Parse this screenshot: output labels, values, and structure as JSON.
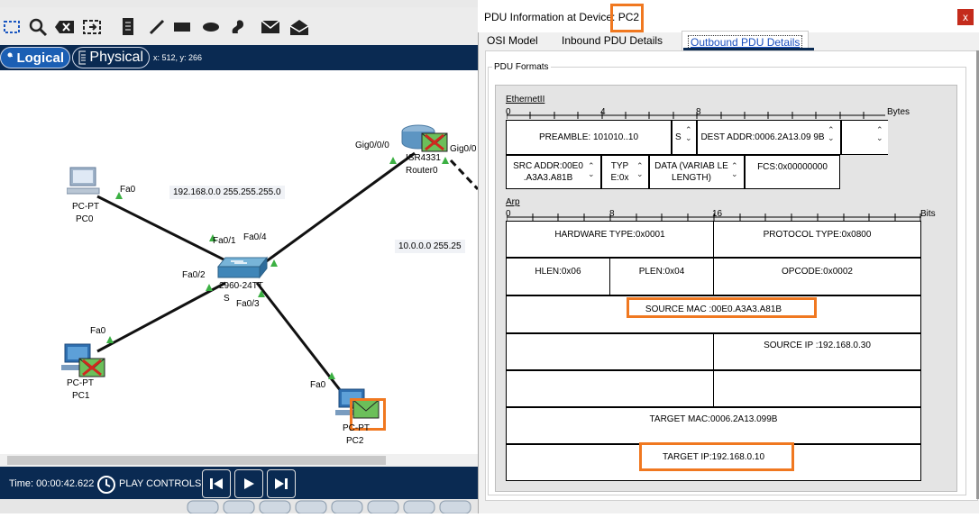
{
  "workspace": {
    "mode_logical": "Logical",
    "mode_physical": "Physical",
    "coords": "x: 512, y: 266",
    "devices": {
      "pc0": {
        "type": "PC-PT",
        "name": "PC0"
      },
      "pc1": {
        "type": "PC-PT",
        "name": "PC1"
      },
      "pc2": {
        "type": "PC-PT",
        "name": "PC2"
      },
      "switch": {
        "type": "2960-24TT",
        "name": "S"
      },
      "router": {
        "type": "ISR4331",
        "name": "Router0"
      }
    },
    "ports": {
      "pc0_fa0": "Fa0",
      "pc1_fa0": "Fa0",
      "pc2_fa0": "Fa0",
      "sw_fa01": "Fa0/1",
      "sw_fa02": "Fa0/2",
      "sw_fa03": "Fa0/3",
      "sw_fa04": "Fa0/4",
      "r_gig000": "Gig0/0/0",
      "r_gig00": "Gig0/0"
    },
    "net_note_1": "192.168.0.0    255.255.255.0",
    "net_note_2": "10.0.0.0    255.25"
  },
  "status": {
    "time": "Time: 00:00:42.622",
    "play_controls": "PLAY CONTROLS:"
  },
  "dialog": {
    "title_prefix": "PDU Information at Device:",
    "device": "PC2",
    "close": "x",
    "tabs": [
      "OSI Model",
      "Inbound PDU Details",
      "Outbound PDU Details"
    ],
    "group_label": "PDU Formats",
    "ethernet": {
      "title": "EthernetII",
      "ruler": {
        "t0": "0",
        "t4": "4",
        "t8": "8",
        "unit": "Bytes"
      },
      "preamble": "PREAMBLE: 101010..10",
      "sfd": "S",
      "dest_addr": "DEST ADDR:0006.2A13.09 9B",
      "src_addr": "SRC ADDR:00E0 .A3A3.A81B",
      "type": "TYP E:0x",
      "data": "DATA (VARIAB LE LENGTH)",
      "fcs": "FCS:0x00000000"
    },
    "arp": {
      "title": "Arp",
      "ruler": {
        "t0": "0",
        "t8": "8",
        "t16": "16",
        "unit": "Bits"
      },
      "hardware_type": "HARDWARE TYPE:0x0001",
      "protocol_type": "PROTOCOL TYPE:0x0800",
      "hlen": "HLEN:0x06",
      "plen": "PLEN:0x04",
      "opcode": "OPCODE:0x0002",
      "source_mac": "SOURCE MAC :00E0.A3A3.A81B",
      "source_ip": "SOURCE IP :192.168.0.30",
      "target_mac": "TARGET MAC:0006.2A13.099B",
      "target_ip": "TARGET IP:192.168.0.10"
    }
  },
  "colors": {
    "accent_dark": "#0a2a52",
    "highlight": "#f07820",
    "link_green": "#3cb043",
    "close_red": "#c42b1c"
  }
}
